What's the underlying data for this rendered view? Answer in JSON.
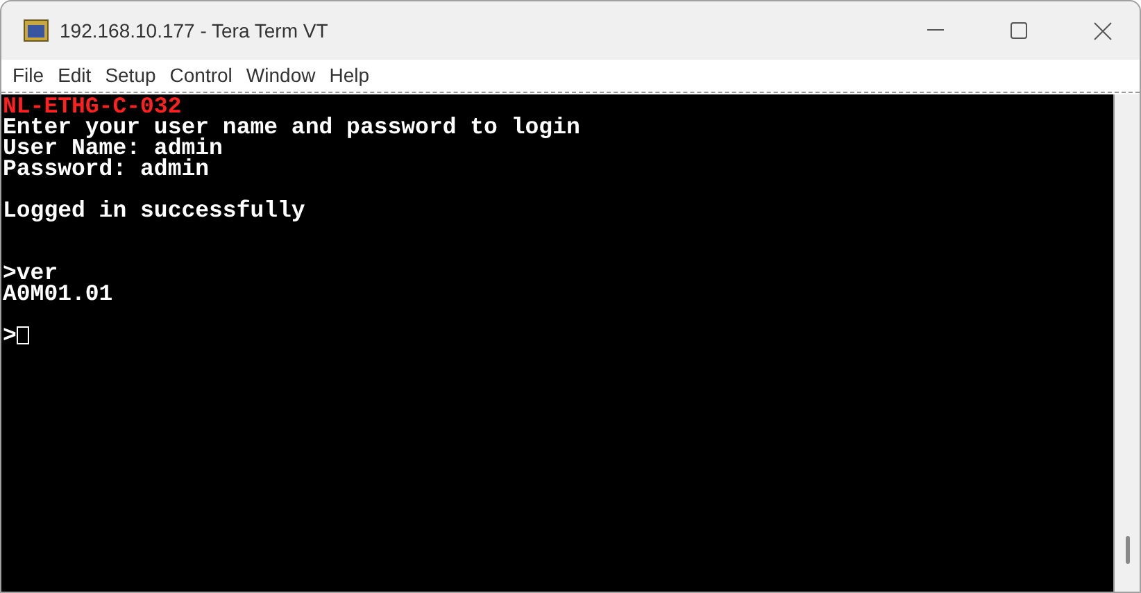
{
  "window": {
    "title": "192.168.10.177 - Tera Term VT"
  },
  "menu": [
    "File",
    "Edit",
    "Setup",
    "Control",
    "Window",
    "Help"
  ],
  "terminal": {
    "lines": [
      {
        "kind": "alert",
        "text": "NL-ETHG-C-032"
      },
      {
        "kind": "normal",
        "text": "Enter your user name and password to login"
      },
      {
        "kind": "normal",
        "text": "User Name: admin"
      },
      {
        "kind": "normal",
        "text": "Password: admin"
      },
      {
        "kind": "blank"
      },
      {
        "kind": "normal",
        "text": "Logged in successfully"
      },
      {
        "kind": "blank"
      },
      {
        "kind": "blank"
      },
      {
        "kind": "normal",
        "text": ">ver"
      },
      {
        "kind": "normal",
        "text": "A0M01.01"
      },
      {
        "kind": "blank"
      },
      {
        "kind": "prompt",
        "text": ">"
      }
    ]
  }
}
